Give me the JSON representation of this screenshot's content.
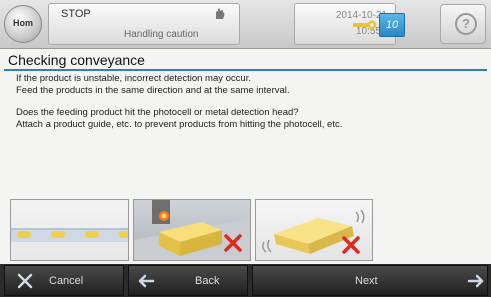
{
  "header": {
    "home_label": "Hom",
    "mode": "STOP",
    "message": "Handling caution",
    "date": "2014-10-21",
    "time": "10:55",
    "badge": "10"
  },
  "page": {
    "title": "Checking conveyance",
    "lines": [
      "If the product is unstable, incorrect detection may occur.",
      "Feed the products in the same direction and at the same interval.",
      "Does the feeding product hit the photocell or metal detection head?",
      "Attach a product guide, etc. to prevent products from hitting the photocell, etc."
    ]
  },
  "footer": {
    "cancel_label": "Cancel",
    "back_label": "Back",
    "next_label": "Next"
  },
  "colors": {
    "accent": "#2d7fc0",
    "error_x": "#e0291b"
  }
}
